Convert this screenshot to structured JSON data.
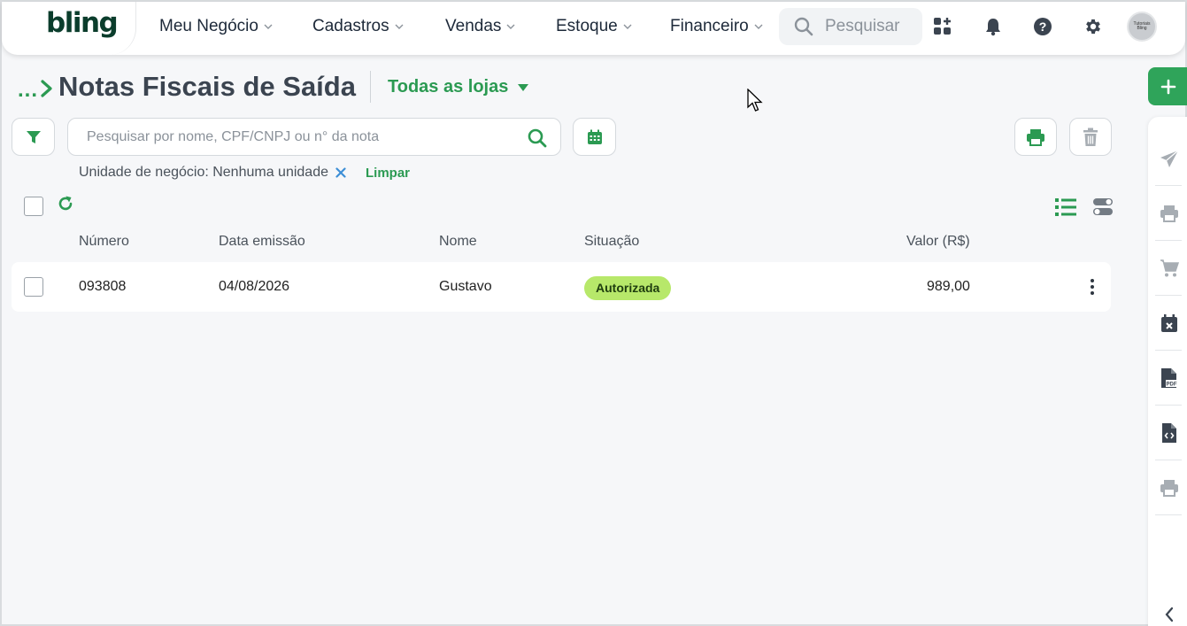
{
  "header": {
    "logo": "bling",
    "nav": [
      {
        "label": "Meu Negócio"
      },
      {
        "label": "Cadastros"
      },
      {
        "label": "Vendas"
      },
      {
        "label": "Estoque"
      },
      {
        "label": "Financeiro"
      }
    ],
    "search_label": "Pesquisar",
    "avatar_text": "Tutoriais Bling"
  },
  "page": {
    "breadcrumb_dots": "...",
    "title": "Notas Fiscais de Saída",
    "store_filter": "Todas as lojas"
  },
  "toolbar": {
    "search_placeholder": "Pesquisar por nome, CPF/CNPJ ou n° da nota"
  },
  "active_filter": {
    "label": "Unidade de negócio: Nenhuma unidade",
    "clear_label": "Limpar"
  },
  "table": {
    "columns": [
      "Número",
      "Data emissão",
      "Nome",
      "Situação",
      "Valor (R$)"
    ],
    "rows": [
      {
        "numero": "093808",
        "data": "04/08/2026",
        "nome": "Gustavo",
        "situacao": "Autorizada",
        "valor": "989,00"
      }
    ]
  },
  "colors": {
    "brand_green": "#2b9a52",
    "status_authorized": "#b7e86a",
    "fab": "#2fa45a"
  },
  "side_rail_icons": [
    "send-icon",
    "print-icon",
    "cart-icon",
    "calendar-x-icon",
    "pdf-file-icon",
    "xml-file-icon",
    "print-icon",
    "chevron-left-icon"
  ]
}
